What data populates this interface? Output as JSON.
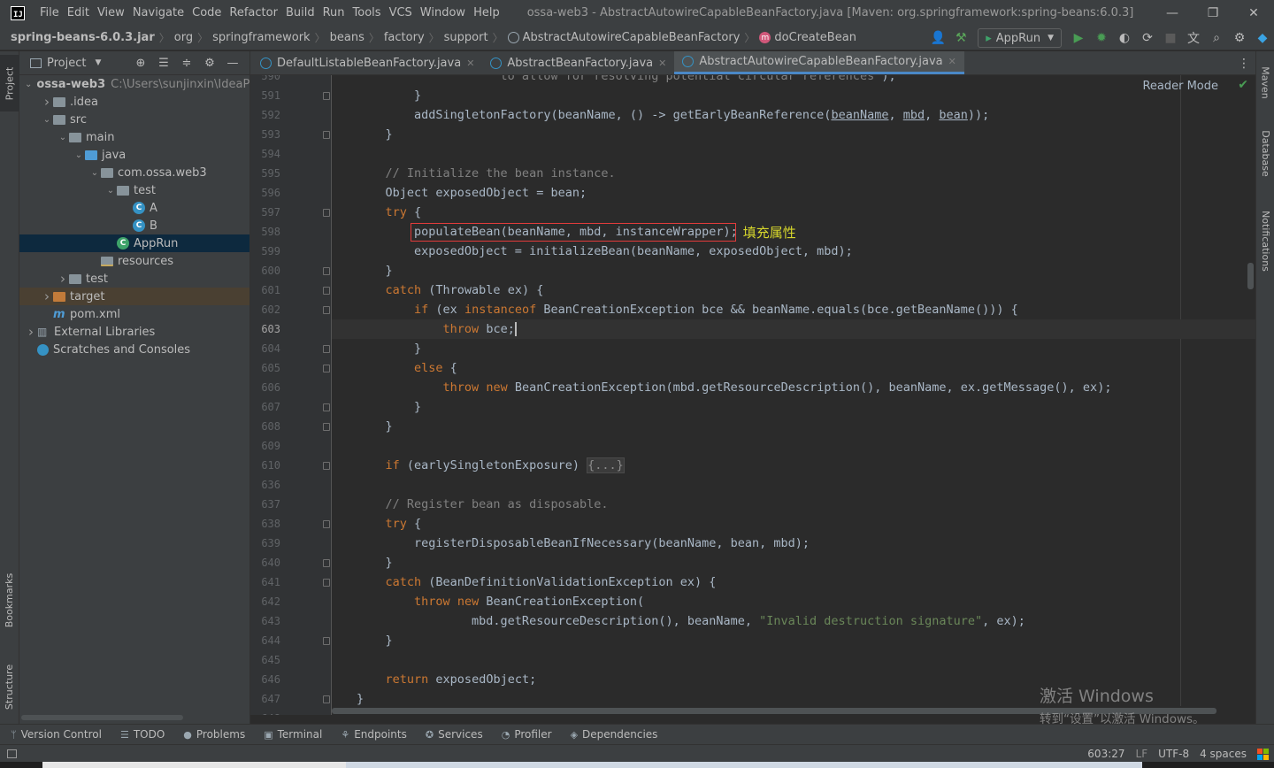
{
  "menubar": {
    "logo": "IJ",
    "items": [
      "File",
      "Edit",
      "View",
      "Navigate",
      "Code",
      "Refactor",
      "Build",
      "Run",
      "Tools",
      "VCS",
      "Window",
      "Help"
    ],
    "window_title": "ossa-web3 - AbstractAutowireCapableBeanFactory.java [Maven: org.springframework:spring-beans:6.0.3]",
    "controls": [
      "—",
      "❐",
      "✕"
    ]
  },
  "navbar": {
    "breadcrumb": [
      "spring-beans-6.0.3.jar",
      "org",
      "springframework",
      "beans",
      "factory",
      "support",
      "AbstractAutowireCapableBeanFactory",
      "doCreateBean"
    ],
    "run_config": "AppRun"
  },
  "left_stripe": {
    "project": "Project",
    "bookmarks": "Bookmarks",
    "structure": "Structure"
  },
  "project_panel": {
    "title": "Project",
    "tree": [
      {
        "label": "ossa-web3",
        "path": "C:\\Users\\sunjinxin\\IdeaPr",
        "indent": 0,
        "arrow": "▾",
        "icon": "folder",
        "bold": true
      },
      {
        "label": ".idea",
        "indent": 1,
        "arrow": "›",
        "icon": "folder"
      },
      {
        "label": "src",
        "indent": 1,
        "arrow": "▾",
        "icon": "folder"
      },
      {
        "label": "main",
        "indent": 2,
        "arrow": "▾",
        "icon": "folder"
      },
      {
        "label": "java",
        "indent": 3,
        "arrow": "▾",
        "icon": "folder-blue"
      },
      {
        "label": "com.ossa.web3",
        "indent": 4,
        "arrow": "▾",
        "icon": "folder"
      },
      {
        "label": "test",
        "indent": 5,
        "arrow": "▾",
        "icon": "folder"
      },
      {
        "label": "A",
        "indent": 6,
        "arrow": "",
        "icon": "class"
      },
      {
        "label": "B",
        "indent": 6,
        "arrow": "",
        "icon": "class"
      },
      {
        "label": "AppRun",
        "indent": 5,
        "arrow": "",
        "icon": "class-run",
        "selected": true
      },
      {
        "label": "resources",
        "indent": 4,
        "arrow": "",
        "icon": "folder-res"
      },
      {
        "label": "test",
        "indent": 2,
        "arrow": "›",
        "icon": "folder"
      },
      {
        "label": "target",
        "indent": 1,
        "arrow": "›",
        "icon": "folder-orange",
        "excluded": true
      },
      {
        "label": "pom.xml",
        "indent": 1,
        "arrow": "",
        "icon": "maven"
      },
      {
        "label": "External Libraries",
        "indent": 0,
        "arrow": "›",
        "icon": "lib"
      },
      {
        "label": "Scratches and Consoles",
        "indent": 0,
        "arrow": "",
        "icon": "scratch"
      }
    ]
  },
  "editor": {
    "tabs": [
      {
        "label": "DefaultListableBeanFactory.java",
        "active": false
      },
      {
        "label": "AbstractBeanFactory.java",
        "active": false
      },
      {
        "label": "AbstractAutowireCapableBeanFactory.java",
        "active": true
      }
    ],
    "reader_mode": "Reader Mode",
    "annotation": "填充属性",
    "caret_position": "603:27",
    "lines": [
      {
        "n": "590",
        "html": "<span class=\"cm\">                    to allow for resolving potential circular references\"</span>);",
        "ind": 0,
        "fold": false
      },
      {
        "n": "591",
        "text": "        }",
        "fold": true
      },
      {
        "n": "592",
        "text": "        addSingletonFactory(beanName, () -> getEarlyBeanReference(BEANNAME, MBD, BEAN));",
        "fold": false,
        "special": "singleton"
      },
      {
        "n": "593",
        "text": "    }",
        "fold": true
      },
      {
        "n": "594",
        "text": "",
        "fold": false
      },
      {
        "n": "595",
        "text": "    // Initialize the bean instance.",
        "fold": false,
        "comment": true
      },
      {
        "n": "596",
        "text": "    Object exposedObject = bean;",
        "fold": false
      },
      {
        "n": "597",
        "text": "    try {",
        "fold": true,
        "kw": "try"
      },
      {
        "n": "598",
        "text": "        populateBean(beanName, mbd, instanceWrapper);",
        "fold": false,
        "boxed": true
      },
      {
        "n": "599",
        "text": "        exposedObject = initializeBean(beanName, exposedObject, mbd);",
        "fold": false
      },
      {
        "n": "600",
        "text": "    }",
        "fold": true
      },
      {
        "n": "601",
        "text": "    catch (Throwable ex) {",
        "fold": true,
        "kw": "catch"
      },
      {
        "n": "602",
        "text": "        if (ex instanceof BeanCreationException bce && beanName.equals(bce.getBeanName())) {",
        "fold": true,
        "special": "if"
      },
      {
        "n": "603",
        "text": "            throw bce;",
        "fold": false,
        "current": true,
        "special": "throwbce"
      },
      {
        "n": "604",
        "text": "        }",
        "fold": true
      },
      {
        "n": "605",
        "text": "        else {",
        "fold": true,
        "kw": "else"
      },
      {
        "n": "606",
        "text": "            throw new BeanCreationException(mbd.getResourceDescription(), beanName, ex.getMessage(), ex);",
        "fold": false,
        "special": "thrownew"
      },
      {
        "n": "607",
        "text": "        }",
        "fold": true
      },
      {
        "n": "608",
        "text": "    }",
        "fold": true
      },
      {
        "n": "609",
        "text": "",
        "fold": false
      },
      {
        "n": "610",
        "text": "    if (earlySingletonExposure) {...}",
        "fold": true,
        "special": "folded"
      },
      {
        "n": "636",
        "text": "",
        "fold": false
      },
      {
        "n": "637",
        "text": "    // Register bean as disposable.",
        "fold": false,
        "comment": true
      },
      {
        "n": "638",
        "text": "    try {",
        "fold": true,
        "kw": "try"
      },
      {
        "n": "639",
        "text": "        registerDisposableBeanIfNecessary(beanName, bean, mbd);",
        "fold": false
      },
      {
        "n": "640",
        "text": "    }",
        "fold": true
      },
      {
        "n": "641",
        "text": "    catch (BeanDefinitionValidationException ex) {",
        "fold": true,
        "kw": "catch"
      },
      {
        "n": "642",
        "text": "        throw new BeanCreationException(",
        "fold": false,
        "special": "thrownew2"
      },
      {
        "n": "643",
        "text": "                mbd.getResourceDescription(), beanName, \"Invalid destruction signature\", ex);",
        "fold": false,
        "special": "string"
      },
      {
        "n": "644",
        "text": "    }",
        "fold": true
      },
      {
        "n": "645",
        "text": "",
        "fold": false
      },
      {
        "n": "646",
        "text": "    return exposedObject;",
        "fold": false,
        "kw": "return"
      },
      {
        "n": "647",
        "text": "}",
        "fold": true
      },
      {
        "n": "648",
        "text": "",
        "fold": false
      }
    ]
  },
  "right_stripe": {
    "maven": "Maven",
    "database": "Database",
    "notifications": "Notifications"
  },
  "bottombar": {
    "tools": [
      {
        "icon": "branch-icon",
        "glyph": "ᛘ",
        "label": "Version Control"
      },
      {
        "icon": "todo-icon",
        "glyph": "☰",
        "label": "TODO"
      },
      {
        "icon": "problems-icon",
        "glyph": "●",
        "label": "Problems"
      },
      {
        "icon": "terminal-icon",
        "glyph": "▣",
        "label": "Terminal"
      },
      {
        "icon": "endpoints-icon",
        "glyph": "⚘",
        "label": "Endpoints"
      },
      {
        "icon": "services-icon",
        "glyph": "✪",
        "label": "Services"
      },
      {
        "icon": "profiler-icon",
        "glyph": "◔",
        "label": "Profiler"
      },
      {
        "icon": "dependencies-icon",
        "glyph": "◈",
        "label": "Dependencies"
      }
    ]
  },
  "statusbar": {
    "position": "603:27",
    "line_sep": "LF",
    "encoding": "UTF-8",
    "indent": "4 spaces"
  },
  "watermark": {
    "title": "激活 Windows",
    "subtitle": "转到“设置”以激活 Windows。"
  },
  "colors": {
    "keyword": "#cc7832",
    "comment": "#808080",
    "string": "#6a8759",
    "text": "#a9b7c6",
    "highlight_box": "#e23b3b",
    "annotation": "#d6d62c"
  }
}
